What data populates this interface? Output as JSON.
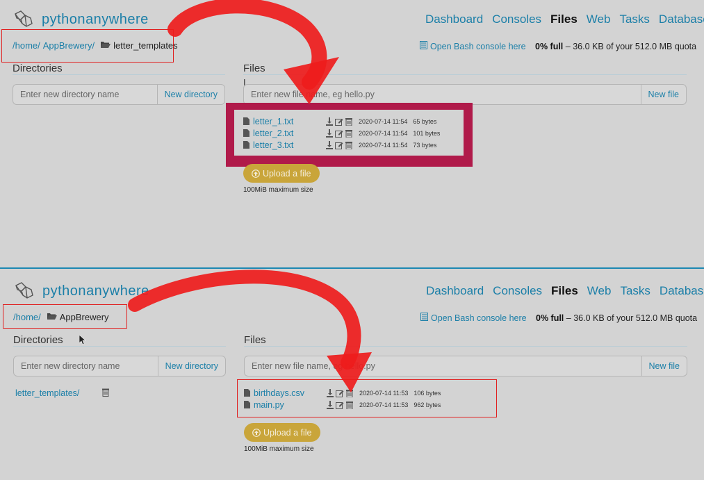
{
  "top": {
    "logo": {
      "text_a": "python",
      "text_b": "anywhere"
    },
    "nav": [
      "Dashboard",
      "Consoles",
      "Files",
      "Web",
      "Tasks",
      "Databases"
    ],
    "nav_active": "Files",
    "breadcrumb": {
      "home": "/home/",
      "user": "AppBrewery/",
      "current": "letter_templates"
    },
    "bash_link": "Open Bash console here",
    "quota": {
      "bold": "0% full",
      "rest": "– 36.0 KB of your 512.0 MB quota"
    },
    "directories": {
      "title": "Directories",
      "placeholder": "Enter new directory name",
      "button": "New directory"
    },
    "files": {
      "title": "Files",
      "placeholder": "Enter new file name, eg hello.py",
      "button": "New file",
      "rows": [
        {
          "name": "letter_1.txt",
          "date": "2020-07-14 11:54",
          "size": "65 bytes"
        },
        {
          "name": "letter_2.txt",
          "date": "2020-07-14 11:54",
          "size": "101 bytes"
        },
        {
          "name": "letter_3.txt",
          "date": "2020-07-14 11:54",
          "size": "73 bytes"
        }
      ],
      "upload": "Upload a file",
      "max_size": "100MiB maximum size"
    },
    "colors": {
      "highlight_box": "#b01a4a",
      "arrow": "#ee1c1c",
      "link": "#1b7fa8"
    }
  },
  "bottom": {
    "logo": {
      "text_a": "python",
      "text_b": "anywhere"
    },
    "nav": [
      "Dashboard",
      "Consoles",
      "Files",
      "Web",
      "Tasks",
      "Databases"
    ],
    "nav_active": "Files",
    "breadcrumb": {
      "home": "/home/",
      "current": "AppBrewery"
    },
    "bash_link": "Open Bash console here",
    "quota": {
      "bold": "0% full",
      "rest": "– 36.0 KB of your 512.0 MB quota"
    },
    "directories": {
      "title": "Directories",
      "placeholder": "Enter new directory name",
      "button": "New directory",
      "items": [
        "letter_templates/"
      ]
    },
    "files": {
      "title": "Files",
      "placeholder": "Enter new file name, eg hello.py",
      "button": "New file",
      "rows": [
        {
          "name": "birthdays.csv",
          "date": "2020-07-14 11:53",
          "size": "106 bytes"
        },
        {
          "name": "main.py",
          "date": "2020-07-14 11:53",
          "size": "962 bytes"
        }
      ],
      "upload": "Upload a file",
      "max_size": "100MiB maximum size"
    }
  }
}
